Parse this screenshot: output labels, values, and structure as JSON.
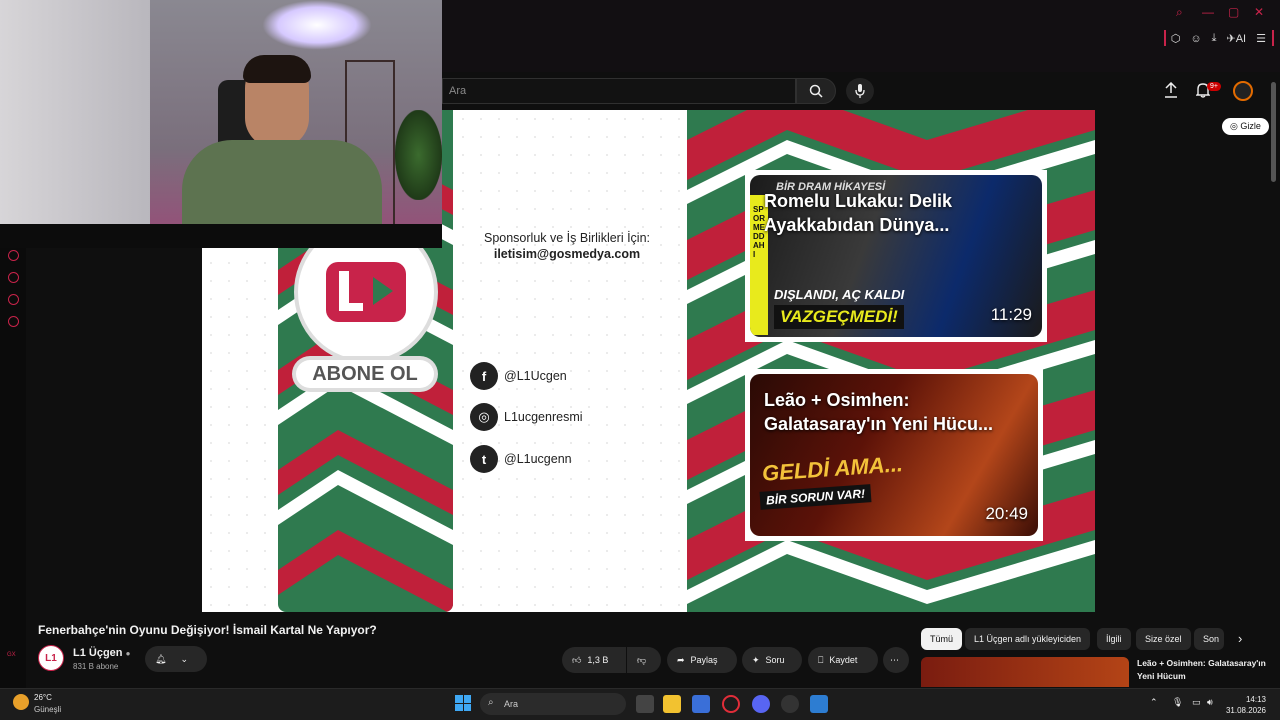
{
  "search": {
    "placeholder": "Ara"
  },
  "header": {
    "notif_badge": "9+"
  },
  "player": {
    "gizle": "Gizle",
    "sponsor_line": "Sponsorluk ve İş Birlikleri İçin:",
    "sponsor_mail": "iletisim@gosmedya.com",
    "abone": "ABONE OL",
    "socials": [
      {
        "label": "@L1Ucgen",
        "icon": "facebook-icon",
        "glyph": "f"
      },
      {
        "label": "L1ucgenresmi",
        "icon": "instagram-icon",
        "glyph": "◎"
      },
      {
        "label": "@L1ucgenn",
        "icon": "twitter-icon",
        "glyph": "t"
      }
    ],
    "cards": [
      {
        "title": "Romelu Lukaku: Delik Ayakkabıdan Dünya...",
        "duration": "11:29",
        "overlay_top": "BİR DRAM HİKAYESİ",
        "overlay_mid": "DIŞLANDI, AÇ KALDI",
        "overlay_bot": "VAZGEÇMEDİ!",
        "side": "SPOR MEDDAHI"
      },
      {
        "title": "Leão + Osimhen: Galatasaray'ın Yeni Hücu...",
        "duration": "20:49",
        "overlay_top": "GELDİ AMA...",
        "overlay_bot": "BİR SORUN VAR!"
      }
    ]
  },
  "video": {
    "title": "Fenerbahçe'nin Oyunu Değişiyor! İsmail Kartal Ne Yapıyor?",
    "channel": "L1 Üçgen",
    "subs": "831 B abone",
    "likes": "1,3 B",
    "share": "Paylaş",
    "ask": "Soru",
    "save": "Kaydet"
  },
  "chips": [
    "Tümü",
    "L1 Üçgen adlı yükleyiciden",
    "İlgili",
    "Size özel",
    "Son"
  ],
  "side_video": {
    "title": "Leão + Osimhen: Galatasaray'ın Yeni Hücum"
  },
  "taskbar": {
    "temp": "26°C",
    "weather": "Güneşli",
    "search": "Ara",
    "time": "14:13",
    "date": "31.08.2026"
  },
  "colors": {
    "brand_red": "#c8234a",
    "stripe_green": "#2f7a4f",
    "stripe_red": "#c0203a",
    "yt_bg": "#0f0f0f"
  }
}
